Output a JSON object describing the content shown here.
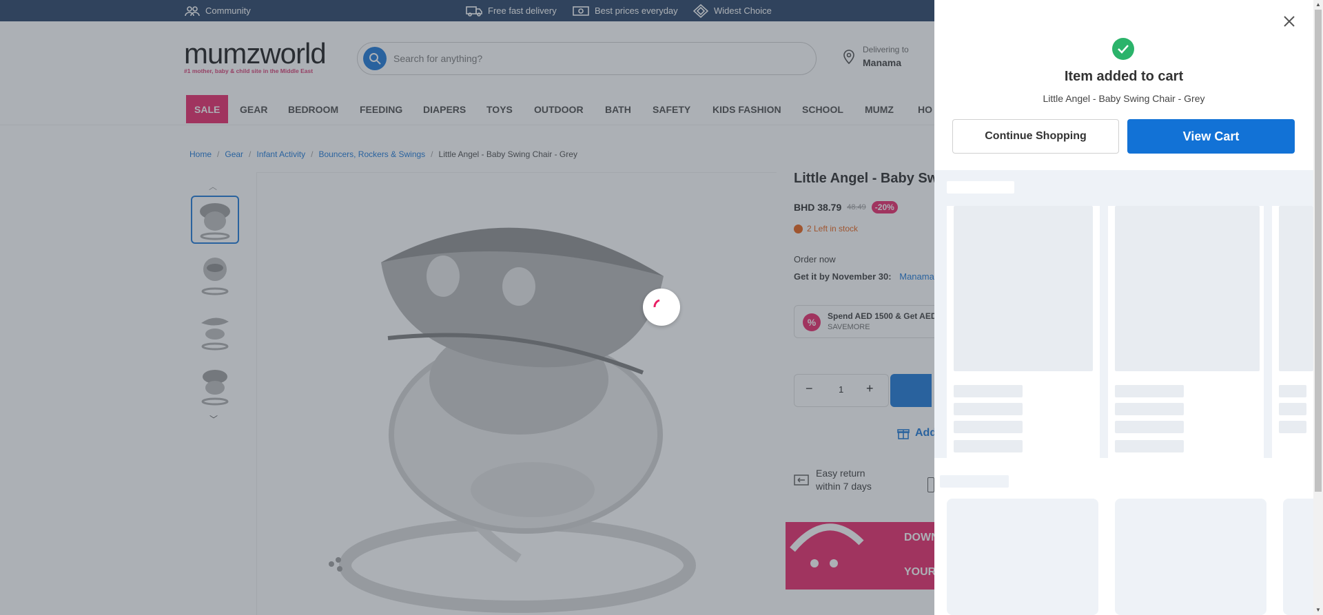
{
  "topbar": {
    "community": "Community",
    "delivery": "Free fast delivery",
    "prices": "Best prices everyday",
    "choice": "Widest Choice"
  },
  "header": {
    "logo_word": "mumzworld",
    "logo_tag": "#1 mother, baby & child site in the Middle East",
    "search_placeholder": "Search for anything?",
    "delivering_to": "Delivering to",
    "location": "Manama"
  },
  "nav": [
    "SALE",
    "GEAR",
    "BEDROOM",
    "FEEDING",
    "DIAPERS",
    "TOYS",
    "OUTDOOR",
    "BATH",
    "SAFETY",
    "KIDS FASHION",
    "SCHOOL",
    "MUMZ",
    "HO"
  ],
  "breadcrumb": [
    "Home",
    "Gear",
    "Infant Activity",
    "Bouncers, Rockers & Swings",
    "Little Angel - Baby Swing Chair - Grey"
  ],
  "product": {
    "title": "Little Angel - Baby Sw",
    "price": "BHD 38.79",
    "old_price": "48.49",
    "discount": "-20%",
    "stock": "2 Left in stock",
    "order_now": "Order now",
    "get_it": "Get it by November 30:",
    "get_it_location": "Manama",
    "promo_title": "Spend AED 1500 & Get AED",
    "promo_code": "SAVEMORE",
    "qty": "1",
    "add_gift": "Add",
    "easy_return_1": "Easy return",
    "easy_return_2": "within 7 days",
    "banner_1": "DOWN",
    "banner_2": "YOUR"
  },
  "drawer": {
    "added_title": "Item added to cart",
    "product_name": "Little Angel - Baby Swing Chair - Grey",
    "continue_label": "Continue Shopping",
    "view_cart_label": "View Cart"
  },
  "colors": {
    "brand_blue": "#1272d6",
    "brand_pink": "#e91e63",
    "success_green": "#2bb36a"
  }
}
